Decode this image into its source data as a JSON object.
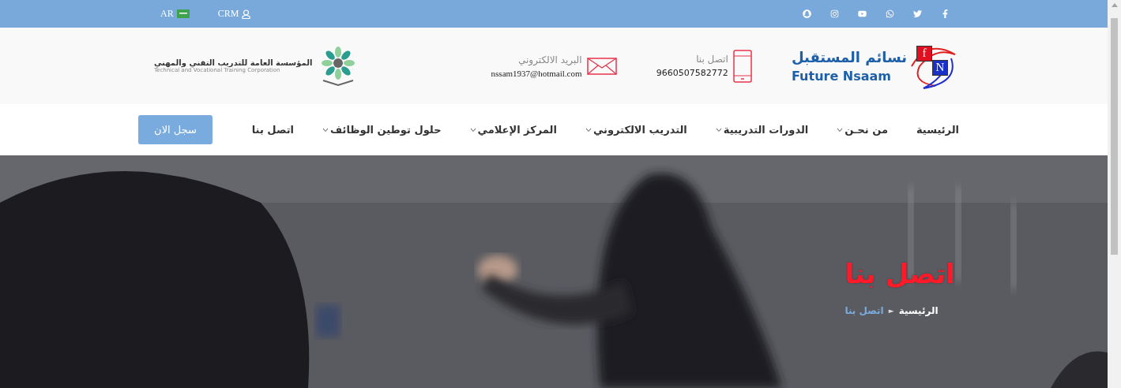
{
  "top_bar": {
    "language": {
      "label": "AR"
    },
    "crm": {
      "label": "CRM"
    }
  },
  "header": {
    "logo": {
      "arabic": "نسائم المستقبل",
      "english": "Future Nsaam",
      "letter_1": "f",
      "letter_2": "N"
    },
    "phone": {
      "label": "اتصل بنا",
      "value": "9660507582772"
    },
    "email": {
      "label": "البريد الالكتروني",
      "value": "nssam1937@hotmail.com"
    },
    "partner": {
      "arabic": "المؤسسة العامة للتدريب التقني والمهني",
      "english": "Technical and Vocational Training Corporation"
    }
  },
  "nav": {
    "items": [
      {
        "label": "الرئيسية",
        "dropdown": false
      },
      {
        "label": "من نحـن",
        "dropdown": true
      },
      {
        "label": "الدورات التدريبية",
        "dropdown": true
      },
      {
        "label": "التدريب الالكتروني",
        "dropdown": true
      },
      {
        "label": "المركز الإعلامي",
        "dropdown": true
      },
      {
        "label": "حلول توطين الوظائف",
        "dropdown": true
      },
      {
        "label": "اتصل بنا",
        "dropdown": false
      }
    ],
    "register_button": "سجل الان"
  },
  "hero": {
    "kind": "picture",
    "title": "اتصل بنا",
    "breadcrumb": [
      {
        "label": "الرئيسية",
        "selected": false
      },
      {
        "label": "اتصل بنا",
        "selected": true
      }
    ],
    "separator": "►"
  }
}
